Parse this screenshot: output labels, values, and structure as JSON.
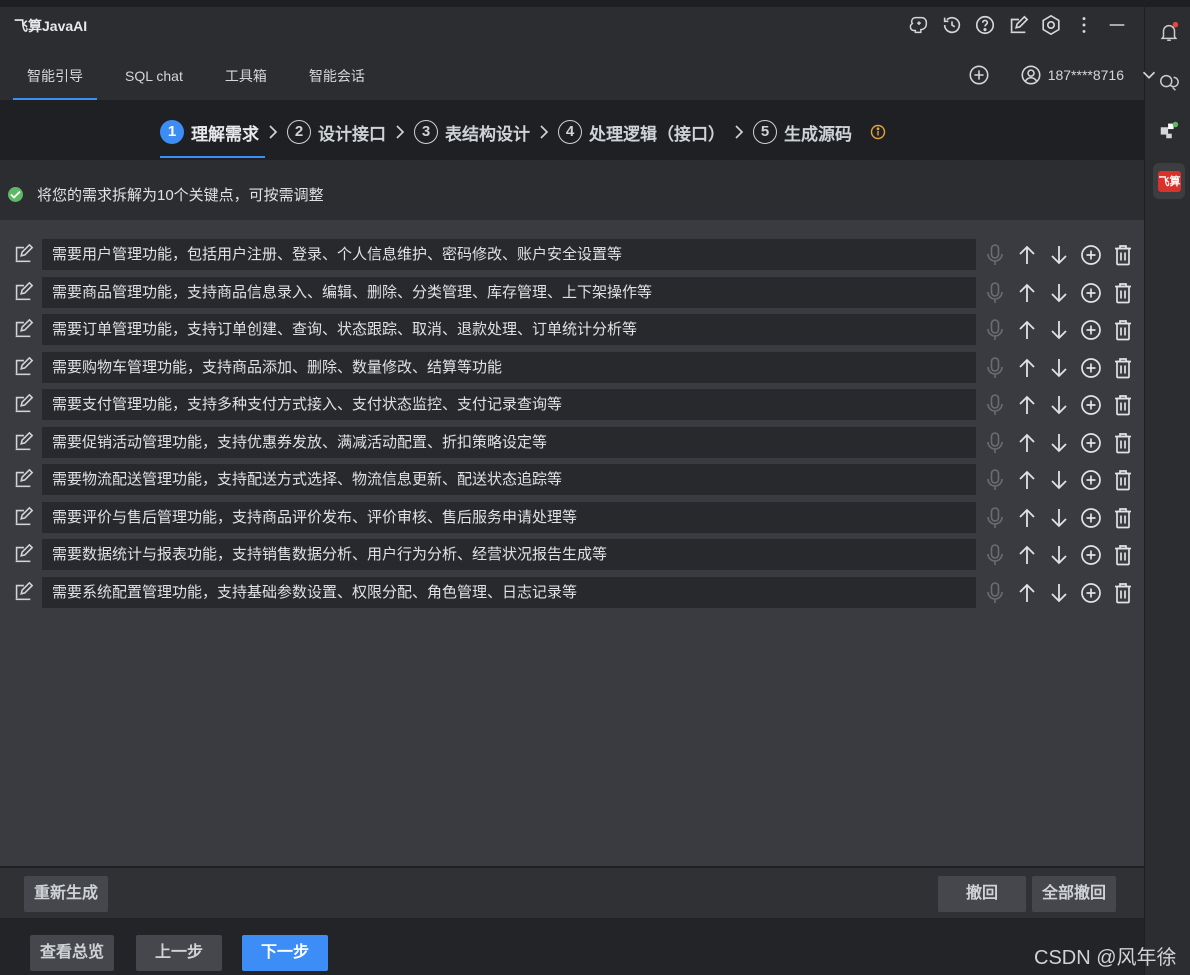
{
  "app": {
    "title": "飞算JavaAI"
  },
  "header_icons": [
    "brain-icon",
    "history-icon",
    "help-icon",
    "edit-icon",
    "settings-icon",
    "more-icon",
    "minimize-icon"
  ],
  "tabs": [
    {
      "label": "智能引导",
      "active": true
    },
    {
      "label": "SQL chat",
      "active": false
    },
    {
      "label": "工具箱",
      "active": false
    },
    {
      "label": "智能会话",
      "active": false
    }
  ],
  "account": {
    "name": "187****8716"
  },
  "steps": [
    {
      "num": "1",
      "label": "理解需求",
      "active": true
    },
    {
      "num": "2",
      "label": "设计接口",
      "active": false
    },
    {
      "num": "3",
      "label": "表结构设计",
      "active": false
    },
    {
      "num": "4",
      "label": "处理逻辑（接口）",
      "active": false
    },
    {
      "num": "5",
      "label": "生成源码",
      "active": false
    }
  ],
  "status_message": "将您的需求拆解为10个关键点，可按需调整",
  "requirements": [
    "需要用户管理功能，包括用户注册、登录、个人信息维护、密码修改、账户安全设置等",
    "需要商品管理功能，支持商品信息录入、编辑、删除、分类管理、库存管理、上下架操作等",
    "需要订单管理功能，支持订单创建、查询、状态跟踪、取消、退款处理、订单统计分析等",
    "需要购物车管理功能，支持商品添加、删除、数量修改、结算等功能",
    "需要支付管理功能，支持多种支付方式接入、支付状态监控、支付记录查询等",
    "需要促销活动管理功能，支持优惠券发放、满减活动配置、折扣策略设定等",
    "需要物流配送管理功能，支持配送方式选择、物流信息更新、配送状态追踪等",
    "需要评价与售后管理功能，支持商品评价发布、评价审核、售后服务申请处理等",
    "需要数据统计与报表功能，支持销售数据分析、用户行为分析、经营状况报告生成等",
    "需要系统配置管理功能，支持基础参数设置、权限分配、角色管理、日志记录等"
  ],
  "buttons": {
    "regenerate": "重新生成",
    "undo": "撤回",
    "undo_all": "全部撤回",
    "overview": "查看总览",
    "prev": "上一步",
    "next": "下一步"
  },
  "watermark": "CSDN @风年徐",
  "colors": {
    "accent": "#3d8df6",
    "success": "#5fb865",
    "warning": "#e5a33b",
    "brand": "#d8322b"
  }
}
